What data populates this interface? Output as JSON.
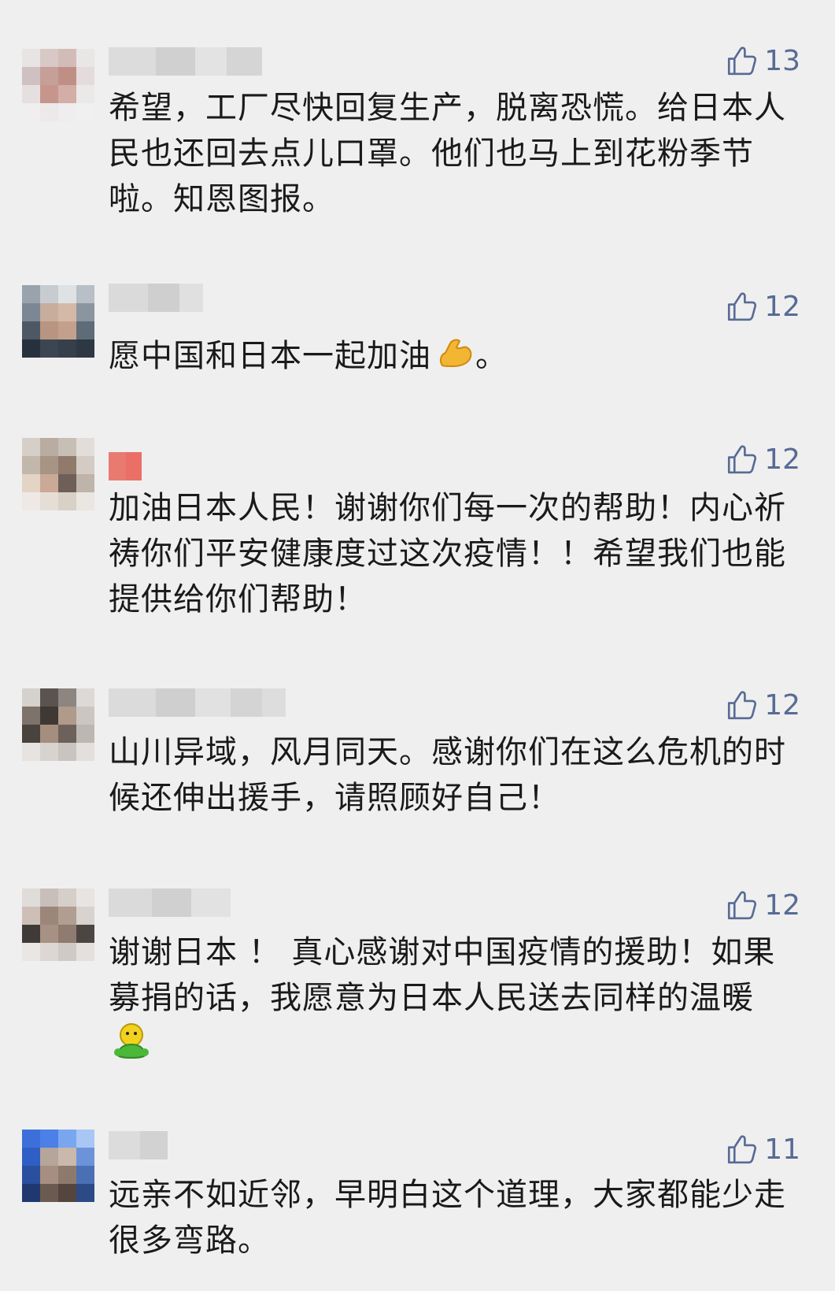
{
  "comments": [
    {
      "likes": "13",
      "text": "希望，工厂尽快回复生产，脱离恐慌。给日本人民也还回去点儿口罩。他们也马上到花粉季节啦。知恩图报。"
    },
    {
      "likes": "12",
      "text": "愿中国和日本一起加油",
      "emoji": "flexed-biceps-emoji",
      "tail": "。"
    },
    {
      "likes": "12",
      "text": "加油日本人民！谢谢你们每一次的帮助！内心祈祷你们平安健康度过这次疫情！！希望我们也能提供给你们帮助！"
    },
    {
      "likes": "12",
      "text": "山川异域，风月同天。感谢你们在这么危机的时候还伸出援手，请照顾好自己！"
    },
    {
      "likes": "12",
      "text": "谢谢日本 ！ 真心感谢对中国疫情的援助！如果募捐的话，我愿意为日本人民送去同样的温暖",
      "emoji": "smiley-hug-emoji"
    },
    {
      "likes": "11",
      "text": "远亲不如近邻，早明白这个道理，大家都能少走很多弯路。"
    }
  ],
  "colors": {
    "background": "#efefef",
    "like": "#576b95",
    "text": "#1a1a1a"
  },
  "icons": {
    "like": "thumbs-up-icon"
  }
}
